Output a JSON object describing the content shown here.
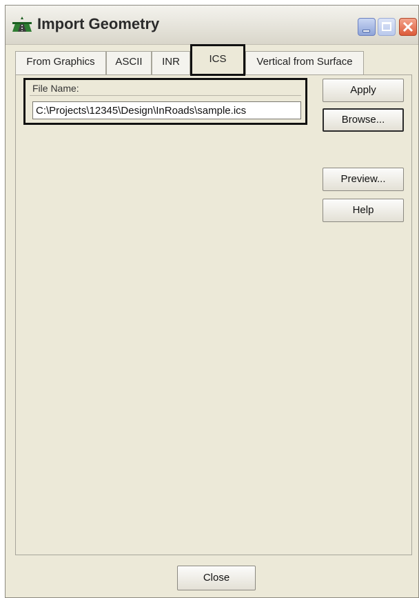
{
  "window": {
    "title": "Import Geometry",
    "controls": [
      "minimize-icon",
      "maximize-icon",
      "close-icon"
    ]
  },
  "tabs": [
    {
      "label": "From Graphics",
      "active": false
    },
    {
      "label": "ASCII",
      "active": false
    },
    {
      "label": "INR",
      "active": false
    },
    {
      "label": "ICS",
      "active": true
    },
    {
      "label": "Vertical from Surface",
      "active": false
    }
  ],
  "file": {
    "label": "File Name:",
    "value": "C:\\Projects\\12345\\Design\\InRoads\\sample.ics"
  },
  "buttons": {
    "apply": "Apply",
    "browse": "Browse...",
    "preview": "Preview...",
    "help": "Help",
    "close": "Close"
  },
  "colors": {
    "dialog_bg": "#ece9d8",
    "highlight_box": "#111111",
    "close_button": "#dc5b3a"
  }
}
